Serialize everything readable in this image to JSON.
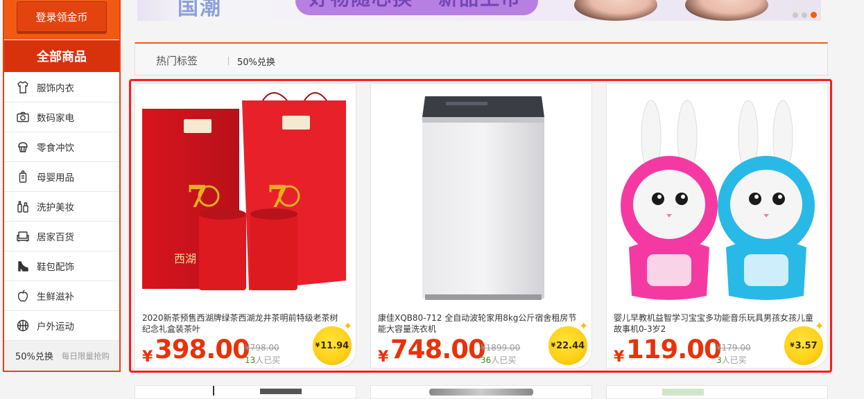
{
  "sidebar": {
    "login_label": "登录领金币",
    "all_label": "全部商品",
    "items": [
      {
        "label": "服饰内衣",
        "icon": "shirt-icon"
      },
      {
        "label": "数码家电",
        "icon": "camera-icon"
      },
      {
        "label": "零食冲饮",
        "icon": "cupcake-icon"
      },
      {
        "label": "母婴用品",
        "icon": "baby-bottle-icon"
      },
      {
        "label": "洗护美妆",
        "icon": "cosmetics-icon"
      },
      {
        "label": "居家百货",
        "icon": "sofa-icon"
      },
      {
        "label": "鞋包配饰",
        "icon": "high-heel-icon"
      },
      {
        "label": "生鲜滋补",
        "icon": "apple-icon"
      },
      {
        "label": "户外运动",
        "icon": "basketball-icon"
      }
    ],
    "footer": {
      "title": "50%兑换",
      "subtitle": "每日限量抢购"
    }
  },
  "tags": {
    "title": "热门标签",
    "items": [
      "50%兑换"
    ]
  },
  "products": [
    {
      "name": "2020新茶预售西湖牌绿茶西湖龙井茶明前特级老茶树纪念礼盒装茶叶",
      "currency": "¥",
      "price": "398.00",
      "original": "¥798.00",
      "sold_count": "13",
      "sold_suffix": "人已买",
      "coin_symbol": "¥",
      "coin": "11.94",
      "image": "tea-gift-box-image"
    },
    {
      "name": "康佳XQB80-712 全自动波轮家用8kg公斤宿舍租房节能大容量洗衣机",
      "currency": "¥",
      "price": "748.00",
      "original": "¥1899.00",
      "sold_count": "36",
      "sold_suffix": "人已买",
      "coin_symbol": "¥",
      "coin": "22.44",
      "image": "washing-machine-image"
    },
    {
      "name": "婴儿早教机益智学习宝宝多功能音乐玩具男孩女孩儿童故事机0-3岁2",
      "currency": "¥",
      "price": "119.00",
      "original": "¥179.00",
      "sold_count": "3",
      "sold_suffix": "人已买",
      "coin_symbol": "¥",
      "coin": "3.57",
      "image": "bunny-story-machine-image"
    }
  ],
  "colors": {
    "brand": "#f25a14",
    "price": "#e8320a",
    "highlight": "#ff1a1a",
    "coin": "#ffd21a"
  }
}
